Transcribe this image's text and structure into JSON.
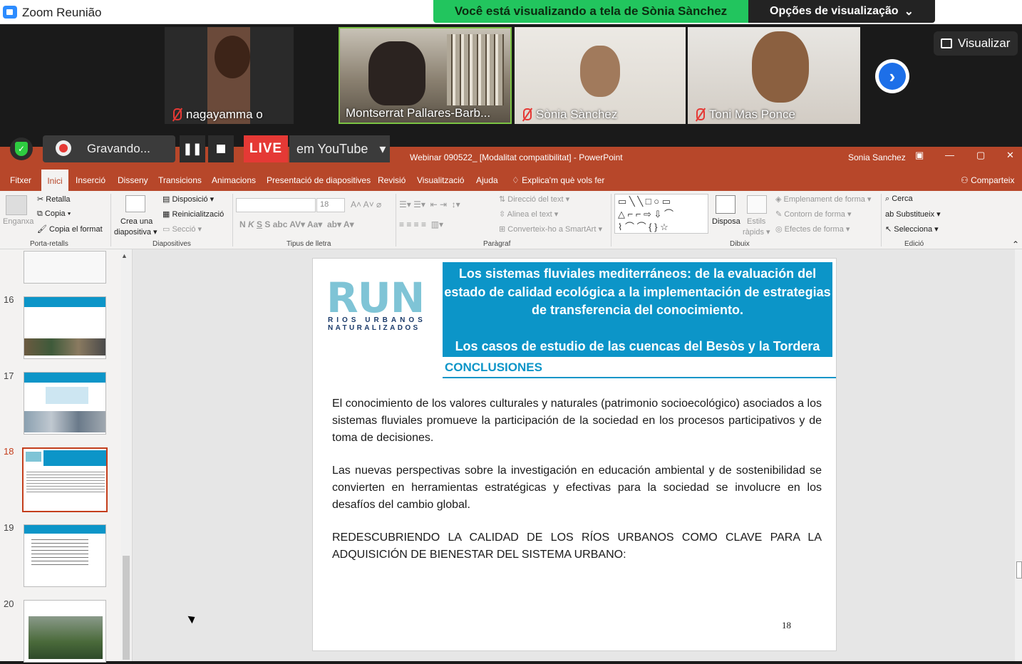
{
  "zoom": {
    "window_title": "Zoom Reunião",
    "share_banner": "Você está visualizando a tela de Sònia Sànchez",
    "view_options": "Opções de visualização",
    "view_button": "Visualizar",
    "participants": [
      {
        "name": "nagayamma o",
        "muted": true
      },
      {
        "name": "Montserrat Pallares-Barb...",
        "muted": false
      },
      {
        "name": "Sònia Sànchez",
        "muted": true
      },
      {
        "name": "Toni Mas Ponce",
        "muted": true
      }
    ],
    "recording_label": "Gravando...",
    "live_label": "LIVE",
    "live_platform": "em YouTube"
  },
  "ppt": {
    "doc_title": "Webinar 090522_ [Modalitat compatibilitat] - PowerPoint",
    "user": "Sonia Sanchez",
    "tabs": [
      "Fitxer",
      "Inici",
      "Inserció",
      "Disseny",
      "Transicions",
      "Animacions",
      "Presentació de diapositives",
      "Revisió",
      "Visualització",
      "Ajuda"
    ],
    "tell_me": "Explica'm què vols fer",
    "share": "Comparteix",
    "ribbon": {
      "paste": "Enganxa",
      "cut": "Retalla",
      "copy": "Copia",
      "format_painter": "Copia el format",
      "clipboard_group": "Porta-retalls",
      "new_slide": "Crea una",
      "new_slide2": "diapositiva",
      "layout": "Disposició",
      "reset": "Reinicialització",
      "section": "Secció",
      "slides_group": "Diapositives",
      "font_size": "18",
      "font_group": "Tipus de lletra",
      "text_direction": "Direcció del text",
      "align_text": "Alinea el text",
      "smartart": "Converteix-ho a SmartArt",
      "paragraph_group": "Paràgraf",
      "arrange": "Disposa",
      "quick_styles": "Estils",
      "quick_styles2": "ràpids",
      "shape_fill": "Emplenament de forma",
      "shape_outline": "Contorn de forma",
      "shape_effects": "Efectes de forma",
      "drawing_group": "Dibuix",
      "find": "Cerca",
      "replace": "Substitueix",
      "select": "Selecciona",
      "editing_group": "Edició"
    },
    "slide_numbers": [
      "16",
      "17",
      "18",
      "19",
      "20"
    ],
    "current_slide": "18"
  },
  "slide": {
    "logo_main": "RUN",
    "logo_sub1": "RIOS URBANOS",
    "logo_sub2": "NATURALIZADOS",
    "title": "Los sistemas fluviales mediterráneos: de la evaluación del estado de calidad ecológica a la implementación de estrategias de transferencia del conocimiento.",
    "subtitle": "Los casos de estudio de las cuencas del Besòs y la Tordera",
    "section_heading": "CONCLUSIONES",
    "paragraph1": "El conocimiento de los valores culturales y naturales (patrimonio socioecológico) asociados a los sistemas fluviales promueve la participación de la sociedad en los procesos participativos y de toma de decisiones.",
    "paragraph2": "Las nuevas perspectivas sobre la investigación en educación ambiental y de sostenibilidad se convierten en herramientas estratégicas y efectivas para la sociedad se involucre en los desafíos del cambio global.",
    "paragraph3": "REDESCUBRIENDO LA CALIDAD DE LOS RÍOS URBANOS COMO CLAVE PARA LA ADQUISICIÓN DE BIENESTAR DEL SISTEMA URBANO:",
    "page_number": "18"
  },
  "colors": {
    "ppt_red": "#b7472a",
    "slide_blue": "#0c95c8",
    "zoom_green": "#22c55e",
    "live_red": "#e53935"
  }
}
